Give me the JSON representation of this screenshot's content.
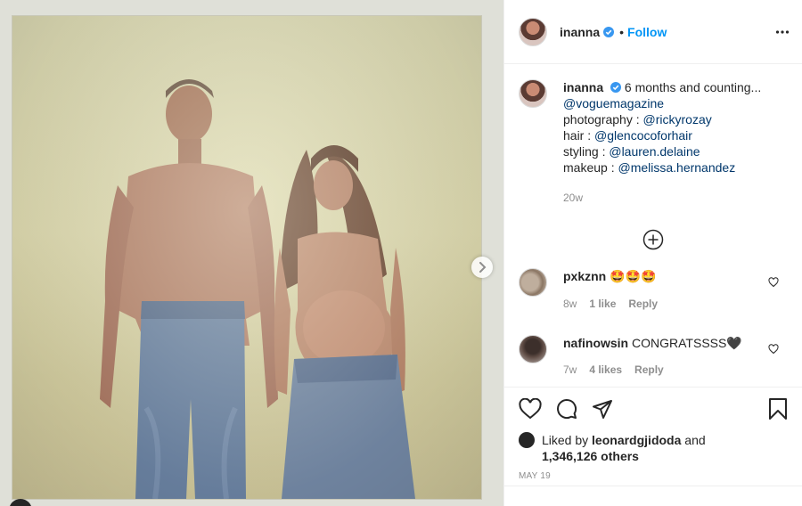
{
  "post": {
    "username": "inanna",
    "follow_label": "Follow",
    "dot": "•",
    "caption": {
      "username": "inanna",
      "text": "6 months and counting...",
      "lines": [
        {
          "prefix": "",
          "mention": "@voguemagazine"
        },
        {
          "prefix": "photography : ",
          "mention": "@rickyrozay"
        },
        {
          "prefix": "hair : ",
          "mention": "@glencocoforhair"
        },
        {
          "prefix": "styling : ",
          "mention": "@lauren.delaine"
        },
        {
          "prefix": "makeup : ",
          "mention": "@melissa.hernandez"
        }
      ],
      "age": "20w"
    },
    "comments": [
      {
        "username": "pxkznn",
        "text": "🤩🤩🤩",
        "age": "8w",
        "likes": "1 like",
        "reply": "Reply"
      },
      {
        "username": "nafinowsin",
        "text": "CONGRATSSSS🖤",
        "age": "7w",
        "likes": "4 likes",
        "reply": "Reply"
      }
    ],
    "liked_by": {
      "prefix": "Liked by ",
      "user": "leonardgjidoda",
      "middle": " and",
      "count": "1,346,126 others"
    },
    "date": "MAY 19"
  },
  "icons": {
    "verified": "verified-badge-icon",
    "more": "more-options-icon",
    "next": "chevron-right-icon",
    "load_more": "plus-circle-icon",
    "like": "heart-icon",
    "comment": "comment-icon",
    "share": "share-icon",
    "save": "bookmark-icon"
  },
  "colors": {
    "accent": "#0095f6",
    "mention": "#00376b",
    "muted": "#8e8e8e",
    "text": "#262626"
  }
}
